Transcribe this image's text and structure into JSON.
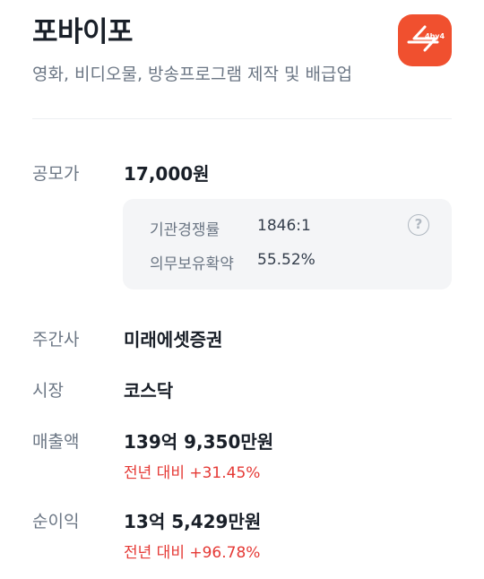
{
  "company": {
    "name": "포바이포",
    "industry": "영화, 비디오물, 방송프로그램 제작 및 배급업",
    "logo_text": "4by4",
    "logo_color": "#f0502f"
  },
  "offer_price": {
    "label": "공모가",
    "value": "17,000원"
  },
  "details": {
    "competition_label": "기관경쟁률",
    "competition_value": "1846:1",
    "lockup_label": "의무보유확약",
    "lockup_value": "55.52%",
    "help_icon_glyph": "?"
  },
  "underwriter": {
    "label": "주간사",
    "value": "미래에셋증권"
  },
  "market": {
    "label": "시장",
    "value": "코스닥"
  },
  "revenue": {
    "label": "매출액",
    "value": "139억 9,350만원",
    "change": "전년 대비 +31.45%"
  },
  "net_income": {
    "label": "순이익",
    "value": "13억 5,429만원",
    "change": "전년 대비 +96.78%"
  },
  "colors": {
    "accent_red": "#e53935",
    "label_gray": "#6b7684",
    "text_dark": "#191f28",
    "box_bg": "#f4f5f7"
  }
}
